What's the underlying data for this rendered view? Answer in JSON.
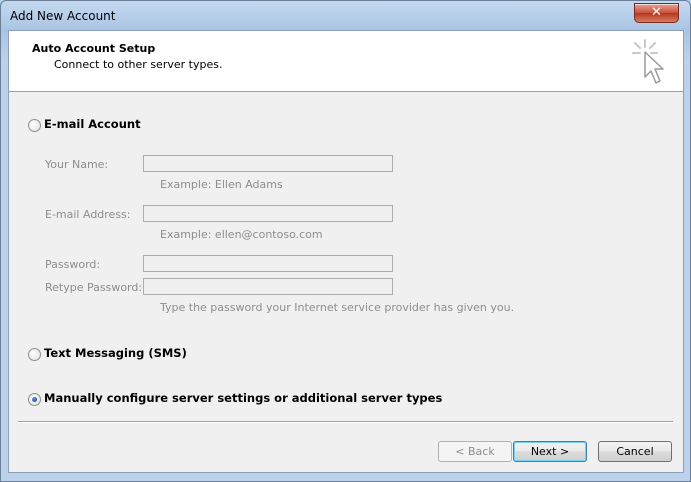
{
  "window": {
    "title": "Add New Account",
    "close_glyph": "✕"
  },
  "header": {
    "title": "Auto Account Setup",
    "subtitle": "Connect to other server types.",
    "icon": "cursor-click-icon"
  },
  "options": {
    "email": {
      "label": "E-mail Account",
      "selected": false,
      "fields": {
        "name": {
          "label": "Your Name:",
          "value": "",
          "hint": "Example: Ellen Adams"
        },
        "email": {
          "label": "E-mail Address:",
          "value": "",
          "hint": "Example: ellen@contoso.com"
        },
        "password": {
          "label": "Password:",
          "value": ""
        },
        "retype": {
          "label": "Retype Password:",
          "value": "",
          "hint": "Type the password your Internet service provider has given you."
        }
      }
    },
    "sms": {
      "label": "Text Messaging (SMS)",
      "selected": false
    },
    "manual": {
      "label": "Manually configure server settings or additional server types",
      "selected": true
    }
  },
  "buttons": {
    "back": "< Back",
    "next": "Next >",
    "cancel": "Cancel"
  },
  "colors": {
    "disabled_text": "#8d8d8d",
    "header_bg": "#ffffff",
    "dialog_bg": "#f0f0f0"
  }
}
